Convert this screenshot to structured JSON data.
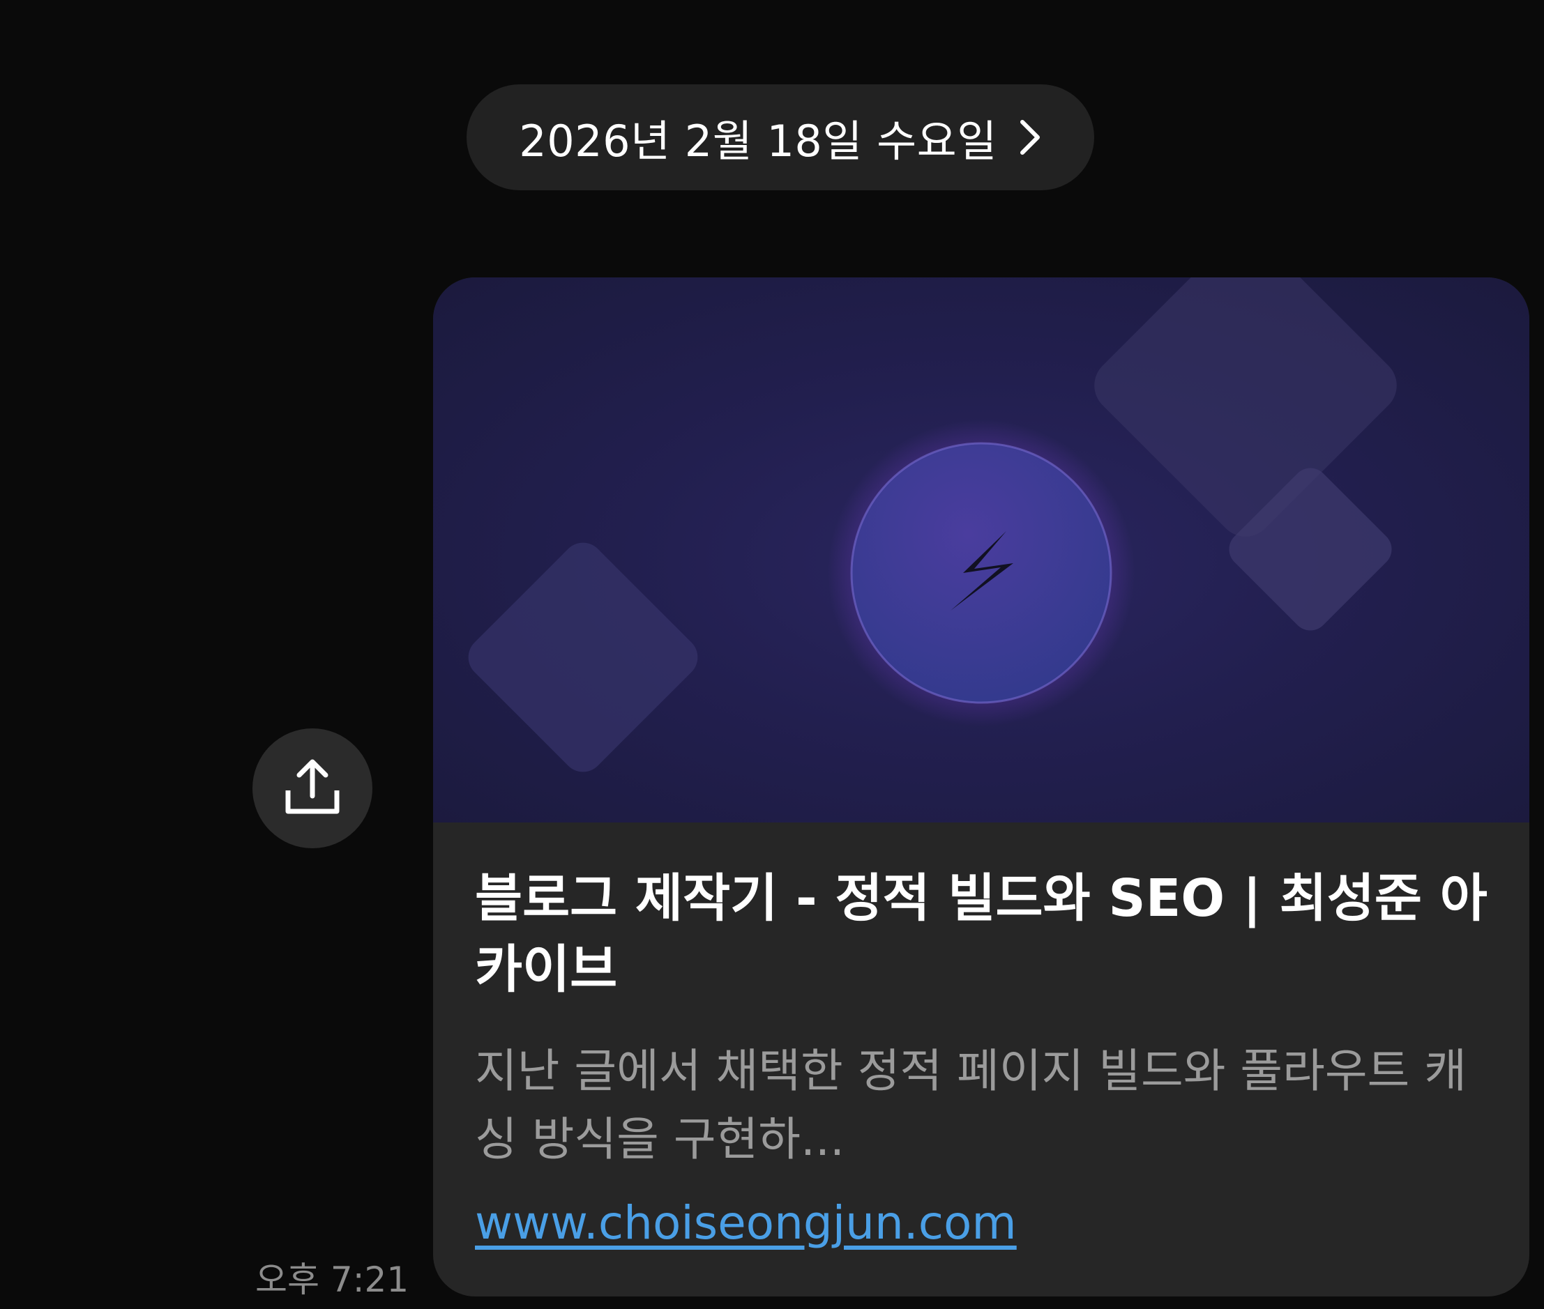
{
  "date_header": {
    "label": "2026년 2월 18일 수요일",
    "chevron_icon": "chevron-right-icon"
  },
  "share_button": {
    "icon": "share-upload-icon"
  },
  "message": {
    "time": "오후 7:21",
    "link_preview": {
      "image_icon": "lightning-bolt-icon",
      "title": "블로그 제작기 - 정적 빌드와 SEO | 최성준 아카이브",
      "description": "지난 글에서 채택한 정적 페이지 빌드와 풀라우트 캐싱 방식을 구현하...",
      "url": "www.choiseongjun.com"
    }
  },
  "colors": {
    "background": "#0a0a0a",
    "pill": "#222222",
    "card": "#262626",
    "link": "#4a9fe6",
    "thumbnail": "#221f4f"
  }
}
